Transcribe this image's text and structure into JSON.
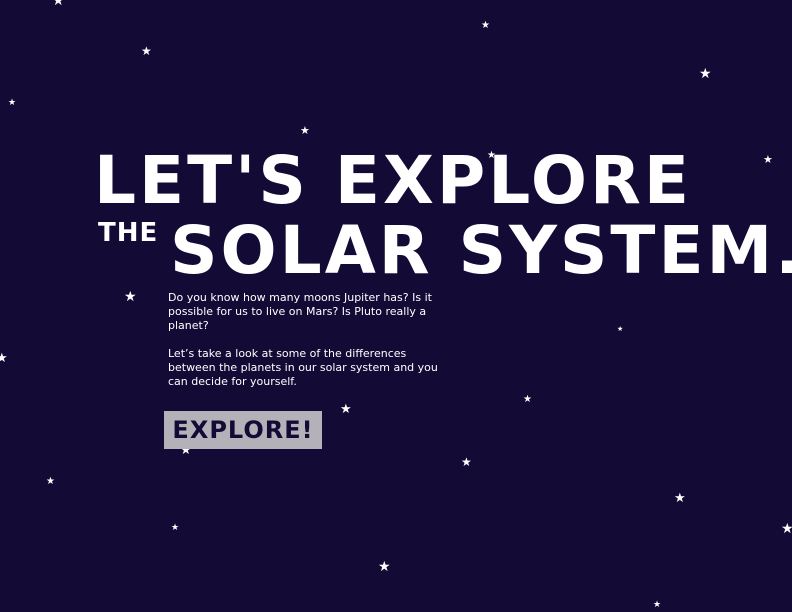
{
  "hero": {
    "line1": "LET'S EXPLORE",
    "the_word": "THE",
    "line2": "SOLAR SYSTEM."
  },
  "intro": {
    "paragraph1": "Do you know how many moons Jupiter has? Is it possible for us to live on Mars? Is Pluto really a planet?",
    "paragraph2": "Let’s take a look at some of the differences between the planets in our solar system and you can decide for yourself."
  },
  "cta": {
    "label": "EXPLORE!"
  },
  "colors": {
    "background": "#130a36",
    "text": "#ffffff",
    "button_bg": "#b4b2b8",
    "button_text": "#130a36"
  },
  "decor": {
    "star_icon": "star-icon"
  }
}
